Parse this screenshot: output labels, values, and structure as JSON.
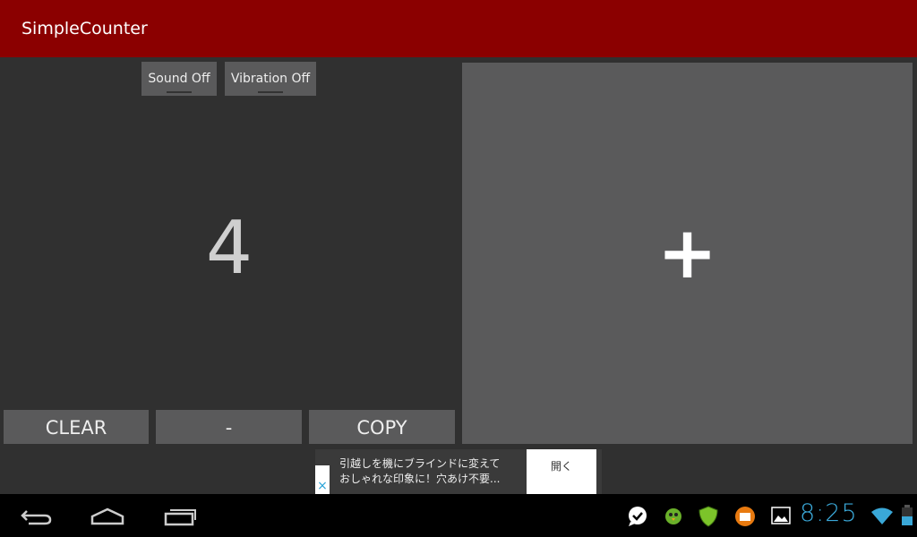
{
  "app": {
    "title": "SimpleCounter"
  },
  "toggles": {
    "sound": "Sound Off",
    "vibration": "Vibration Off"
  },
  "counter": {
    "value": "4"
  },
  "buttons": {
    "plus": "+",
    "clear": "CLEAR",
    "minus": "-",
    "copy": "COPY"
  },
  "ad": {
    "line1": "引越しを機にブラインドに変えて",
    "line2": "おしゃれな印象に！穴あけ不要...",
    "open": "開く",
    "close": "×"
  },
  "status": {
    "time": "8:25",
    "icons": [
      "chat-check-icon",
      "green-bird-icon",
      "shield-icon",
      "orange-folder-icon",
      "gallery-icon",
      "wifi-icon",
      "battery-icon"
    ]
  },
  "colors": {
    "titlebar": "#8b0000",
    "clock": "#3aa8d8"
  }
}
